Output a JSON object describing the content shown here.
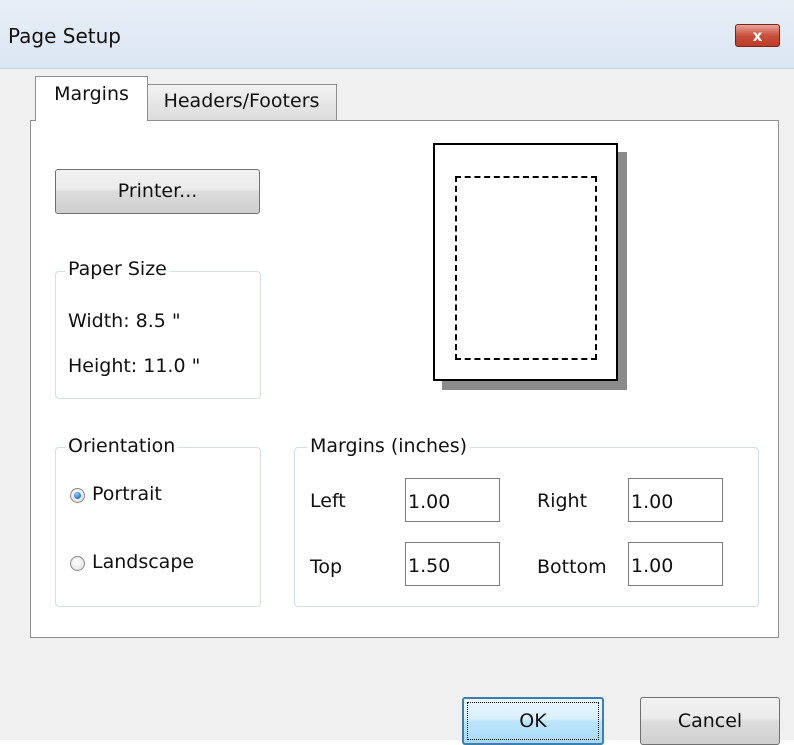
{
  "window": {
    "title": "Page Setup",
    "close_glyph": "x"
  },
  "tabs": [
    {
      "label": "Margins",
      "selected": true
    },
    {
      "label": "Headers/Footers",
      "selected": false
    }
  ],
  "printer_button": {
    "label": "Printer..."
  },
  "paper_size": {
    "legend": "Paper Size",
    "width_text": "Width: 8.5 \"",
    "height_text": "Height: 11.0 \""
  },
  "orientation": {
    "legend": "Orientation",
    "options": [
      {
        "label": "Portrait",
        "checked": true
      },
      {
        "label": "Landscape",
        "checked": false
      }
    ]
  },
  "margins": {
    "legend": "Margins (inches)",
    "left": {
      "label": "Left",
      "value": "1.00"
    },
    "right": {
      "label": "Right",
      "value": "1.00"
    },
    "top": {
      "label": "Top",
      "value": "1.50"
    },
    "bottom": {
      "label": "Bottom",
      "value": "1.00"
    }
  },
  "buttons": {
    "ok": "OK",
    "cancel": "Cancel"
  },
  "colors": {
    "accent": "#3c7fb1",
    "close_button": "#c9503c",
    "titlebar": "#dbe6f3",
    "preview_shadow": "#8b8b8b"
  }
}
